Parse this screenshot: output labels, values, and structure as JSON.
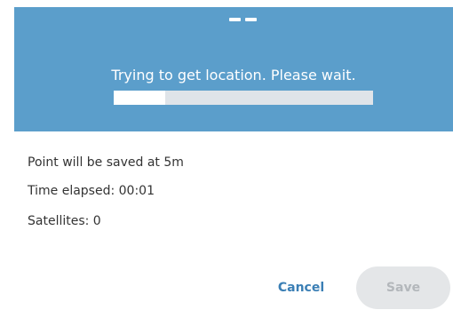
{
  "colors": {
    "header_bg": "#5b9ecb",
    "accent": "#3b7fb5",
    "disabled_bg": "#e4e6e8",
    "disabled_text": "#b3b7bb"
  },
  "header": {
    "accuracy_text": "--",
    "message": "Trying to get location. Please wait.",
    "progress": 0.2
  },
  "info": {
    "save_at": "Point will be saved at 5m",
    "time_elapsed": "Time elapsed: 00:01",
    "satellites": "Satellites: 0"
  },
  "actions": {
    "cancel_label": "Cancel",
    "save_label": "Save"
  }
}
